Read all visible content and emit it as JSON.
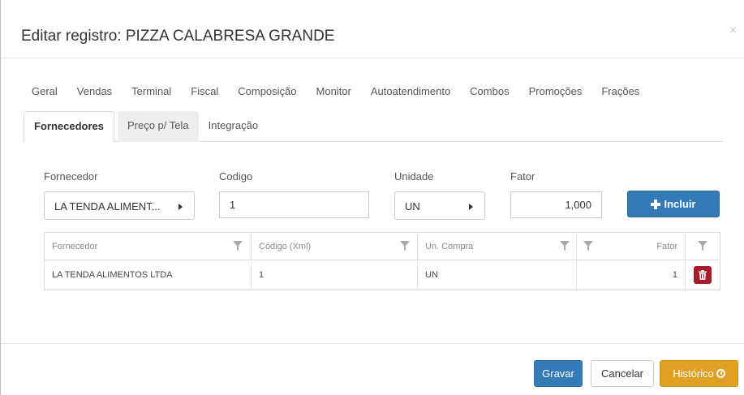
{
  "modal": {
    "title": "Editar registro: PIZZA CALABRESA GRANDE",
    "close_glyph": "×"
  },
  "tabs_row1": [
    "Geral",
    "Vendas",
    "Terminal",
    "Fiscal",
    "Composição",
    "Monitor",
    "Autoatendimento",
    "Combos",
    "Promoções",
    "Frações"
  ],
  "tabs_row2": [
    "Fornecedores",
    "Preço p/ Tela",
    "Integração"
  ],
  "active_tab": "Fornecedores",
  "form": {
    "fornecedor_label": "Fornecedor",
    "fornecedor_value": "LA TENDA ALIMENT...",
    "codigo_label": "Codigo",
    "codigo_value": "1",
    "unidade_label": "Unidade",
    "unidade_value": "UN",
    "fator_label": "Fator",
    "fator_value": "1,000",
    "incluir_label": "Incluir"
  },
  "grid": {
    "columns": [
      "Fornecedor",
      "Código (Xml)",
      "Un. Compra",
      "Fator"
    ],
    "rows": [
      {
        "fornecedor": "LA TENDA ALIMENTOS LTDA",
        "codigo": "1",
        "un_compra": "UN",
        "fator": "1"
      }
    ]
  },
  "footer": {
    "gravar": "Gravar",
    "cancelar": "Cancelar",
    "historico": "Histórico"
  },
  "colors": {
    "primary": "#337ab7",
    "danger": "#a71b2b",
    "warning": "#e0a024"
  }
}
